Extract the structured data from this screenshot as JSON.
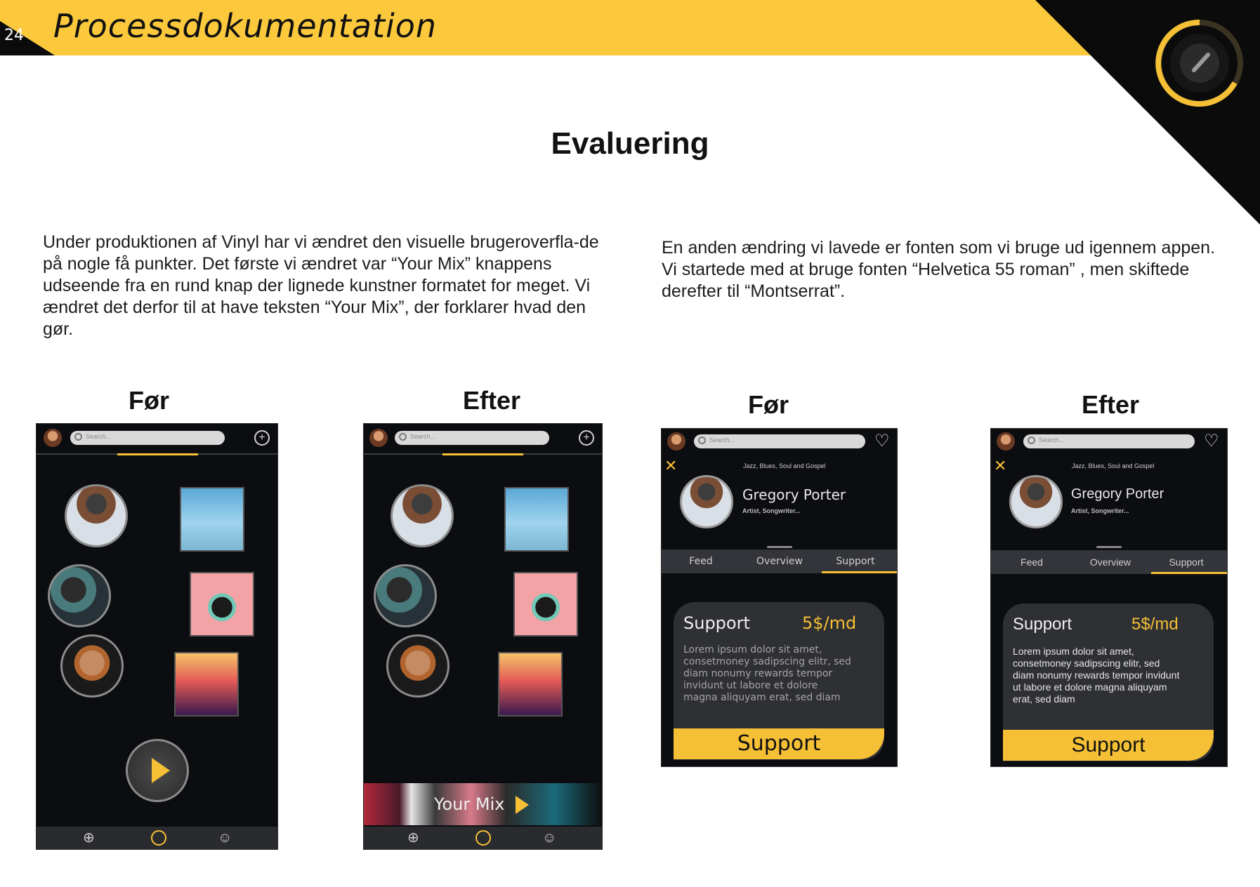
{
  "header": {
    "page_number": "24",
    "title": "Processdokumentation"
  },
  "section_title": "Evaluering",
  "paragraphs": {
    "left": "Under produktionen af Vinyl har vi ændret den visuelle brugeroverfla-de på nogle få punkter. Det første vi ændret var “Your Mix” knappens udseende fra en rund knap der lignede kunstner formatet for meget. Vi ændret det derfor til at have teksten “Your Mix”, der forklarer hvad den gør.",
    "right": "En anden ændring vi lavede er fonten som vi bruge ud igennem appen. Vi startede med at bruge fonten “Helvetica 55 roman” , men skiftede derefter til “Montserrat”."
  },
  "labels": {
    "before_1": "Før",
    "after_1": "Efter",
    "before_2": "Før",
    "after_2": "Efter"
  },
  "home_screen": {
    "search_placeholder": "Search...",
    "your_mix_label": "Your Mix",
    "icons": [
      "profile-avatar",
      "search-icon",
      "add-icon",
      "globe-icon",
      "home-ring-icon",
      "user-icon",
      "play-icon"
    ],
    "accent_color": "#f5c035"
  },
  "artist_screen": {
    "search_placeholder": "Search...",
    "genre": "Jazz, Blues, Soul and Gospel",
    "artist_name": "Gregory Porter",
    "artist_sub": "Artist, Songwriter...",
    "tabs": [
      "Feed",
      "Overview",
      "Support"
    ],
    "active_tab": "Support",
    "card_title": "Support",
    "price": "5$/md",
    "lorem": "Lorem ipsum dolor sit amet, consetmoney sadipscing elitr, sed diam nonumy rewards tempor invidunt ut labore et dolore magna aliquyam erat, sed diam",
    "button": "Support",
    "icons": [
      "heart-icon",
      "close-icon"
    ]
  },
  "colors": {
    "header_yellow": "#fcc93d",
    "app_background": "#0c0d10",
    "accent": "#f5c035"
  }
}
